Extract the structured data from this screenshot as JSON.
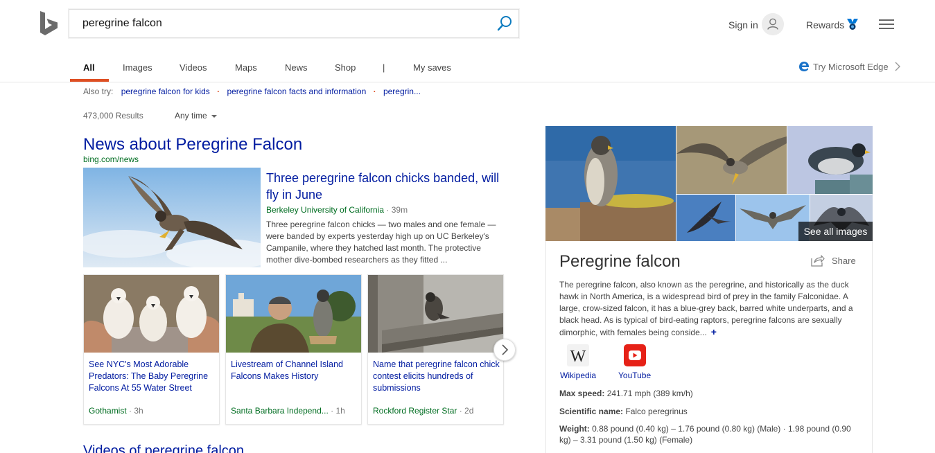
{
  "search": {
    "query": "peregrine falcon"
  },
  "header": {
    "signin_label": "Sign in",
    "rewards_label": "Rewards"
  },
  "tabs": [
    {
      "label": "All"
    },
    {
      "label": "Images"
    },
    {
      "label": "Videos"
    },
    {
      "label": "Maps"
    },
    {
      "label": "News"
    },
    {
      "label": "Shop"
    },
    {
      "label": "|"
    },
    {
      "label": "My saves"
    }
  ],
  "edge_promo": "Try Microsoft Edge",
  "also_try": {
    "label": "Also try:",
    "items": [
      "peregrine falcon for kids",
      "peregrine falcon facts and information",
      "peregrin..."
    ]
  },
  "results": {
    "count": "473,000 Results",
    "time_filter": "Any time"
  },
  "news": {
    "title": "News about Peregrine Falcon",
    "source_url": "bing.com/news",
    "main": {
      "headline": "Three peregrine falcon chicks banded, will fly in June",
      "source": "Berkeley University of California",
      "age": " · 39m",
      "snippet": "Three peregrine falcon chicks — two males and one female — were banded by experts yesterday high up on UC Berkeley's Campanile, where they hatched last month. The protective mother dive-bombed researchers as they fitted ..."
    },
    "cards": [
      {
        "title": "See NYC's Most Adorable Predators: The Baby Peregrine Falcons At 55 Water Street",
        "source": "Gothamist",
        "age": " · 3h"
      },
      {
        "title": "Livestream of Channel Island Falcons Makes History",
        "source": "Santa Barbara Independ...",
        "age": " · 1h"
      },
      {
        "title": "Name that peregrine falcon chick contest elicits hundreds of submissions",
        "source": "Rockford Register Star",
        "age": " · 2d"
      }
    ]
  },
  "videos": {
    "title": "Videos of peregrine falcon"
  },
  "knowledge_panel": {
    "see_all_images": "See all images",
    "title": "Peregrine falcon",
    "share_label": "Share",
    "description": "The peregrine falcon, also known as the peregrine, and historically as the duck hawk in North America, is a widespread bird of prey in the family Falconidae. A large, crow-sized falcon, it has a blue-grey back, barred white underparts, and a black head. As is typical of bird-eating raptors, peregrine falcons are sexually dimorphic, with females being conside...",
    "more": "+",
    "links": [
      {
        "label": "Wikipedia",
        "icon": "wikipedia-icon"
      },
      {
        "label": "YouTube",
        "icon": "youtube-icon"
      }
    ],
    "facts": [
      {
        "key": "Max speed:",
        "value": " 241.71 mph (389 km/h)"
      },
      {
        "key": "Scientific name:",
        "value": " Falco peregrinus"
      },
      {
        "key": "Weight:",
        "value": " 0.88 pound (0.40 kg) – 1.76 pound (0.80 kg) (Male) · 1.98 pound (0.90 kg) – 3.31 pound (1.50 kg) (Female)"
      }
    ]
  },
  "colors": {
    "link": "#001ba0",
    "source_green": "#006d21",
    "accent": "#de4f23",
    "bing_teal": "#008373"
  }
}
